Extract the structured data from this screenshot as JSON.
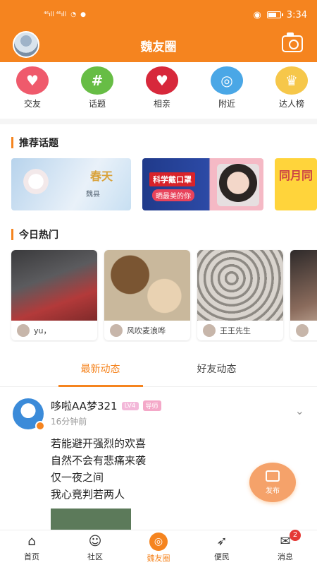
{
  "status": {
    "signal_left": "⁴⁶ıll ⁴⁶ıll",
    "time": "3:34"
  },
  "header": {
    "title": "魏友圈"
  },
  "categories": [
    {
      "label": "交友",
      "color": "#ef5a6c",
      "icon": "heart-icon"
    },
    {
      "label": "话题",
      "color": "#67bd45",
      "icon": "hashtag-icon"
    },
    {
      "label": "相亲",
      "color": "#d7283b",
      "icon": "heart-icon"
    },
    {
      "label": "附近",
      "color": "#4aa7e6",
      "icon": "location-icon"
    },
    {
      "label": "达人榜",
      "color": "#f6c74a",
      "icon": "crown-icon"
    }
  ],
  "sections": {
    "topics_title": "推荐话题",
    "hot_title": "今日热门"
  },
  "topics": [
    {
      "text": "春天",
      "sub": "魏县"
    },
    {
      "text": "科学戴口罩",
      "sub": "晒最美的你"
    },
    {
      "text": "同月同"
    }
  ],
  "hot": [
    {
      "name": "yu，"
    },
    {
      "name": "风吹麦浪哗"
    },
    {
      "name": "王王先生"
    },
    {
      "name": ""
    }
  ],
  "tabs": {
    "latest": "最新动态",
    "friends": "好友动态"
  },
  "post": {
    "username": "哆啦AA梦321",
    "level": "LV4",
    "role": "导师",
    "time": "16分钟前",
    "lines": [
      "若能避开强烈的欢喜",
      "自然不会有悲痛来袭",
      "仅一夜之间",
      "我心竟判若两人"
    ]
  },
  "fab": {
    "label": "发布"
  },
  "bottom_nav": [
    {
      "label": "首页",
      "icon": "home-icon"
    },
    {
      "label": "社区",
      "icon": "community-icon"
    },
    {
      "label": "魏友圈",
      "icon": "circle-icon"
    },
    {
      "label": "便民",
      "icon": "rocket-icon"
    },
    {
      "label": "消息",
      "icon": "message-icon",
      "badge": "2"
    }
  ]
}
